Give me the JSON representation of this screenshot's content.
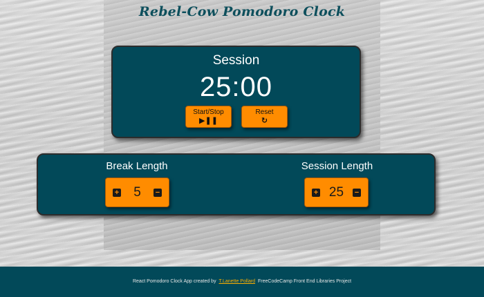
{
  "app": {
    "title": "Rebel-Cow Pomodoro Clock"
  },
  "session": {
    "label": "Session",
    "time": "25:00",
    "start_stop_label": "Start/Stop",
    "start_stop_icon": "play-pause-icon",
    "reset_label": "Reset",
    "reset_icon": "refresh-icon"
  },
  "break_length": {
    "label": "Break Length",
    "value": "5"
  },
  "session_length": {
    "label": "Session Length",
    "value": "25"
  },
  "footer": {
    "prefix": "React Pomodoro Clock App created by",
    "author": "T.Lanette Pollard",
    "suffix": "FreeCodeCamp Front End Libraries Project"
  },
  "colors": {
    "card": "#024959",
    "accent": "#ff8c00",
    "title": "#0d4f5c",
    "link": "#ffb000"
  }
}
